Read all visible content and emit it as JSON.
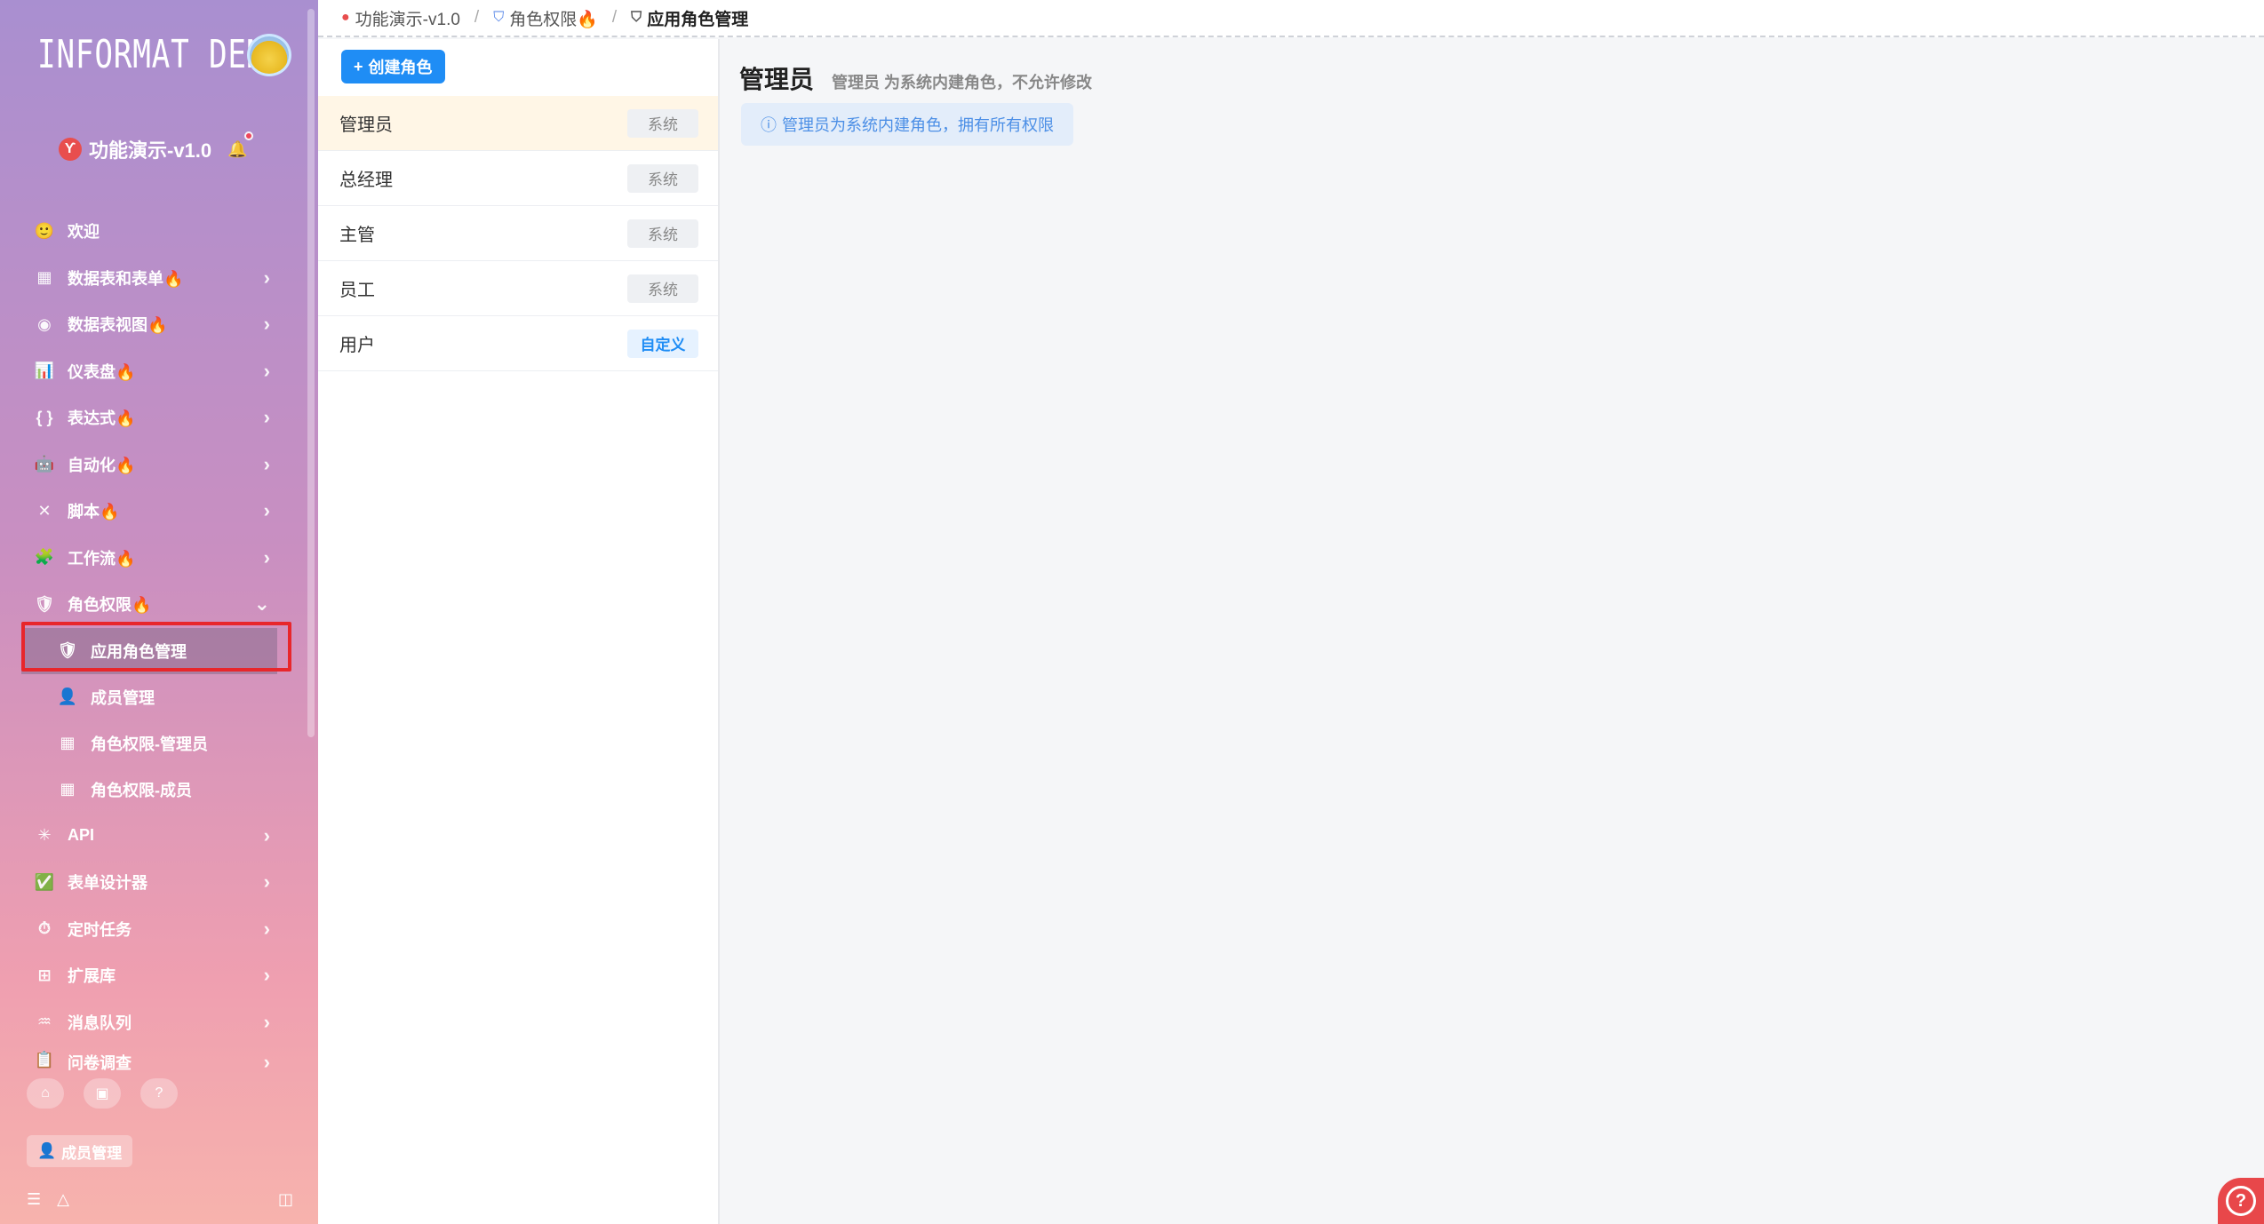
{
  "sidebar": {
    "logo_text": "INFORMAT DEMO",
    "app_name": "功能演示-v1.0",
    "menu": [
      {
        "icon": "🙂",
        "label": "欢迎"
      },
      {
        "icon": "▦",
        "label": "数据表和表单🔥",
        "chevron": "›"
      },
      {
        "icon": "◉",
        "label": "数据表视图🔥",
        "chevron": "›"
      },
      {
        "icon": "📊",
        "label": "仪表盘🔥",
        "chevron": "›"
      },
      {
        "icon": "{ }",
        "label": "表达式🔥",
        "chevron": "›"
      },
      {
        "icon": "🤖",
        "label": "自动化🔥",
        "chevron": "›"
      },
      {
        "icon": "✕",
        "label": "脚本🔥",
        "chevron": "›"
      },
      {
        "icon": "🧩",
        "label": "工作流🔥",
        "chevron": "›"
      },
      {
        "icon": "🛡",
        "label": "角色权限🔥",
        "chevron": "⌄"
      }
    ],
    "submenu": [
      {
        "icon": "🛡",
        "label": "应用角色管理"
      },
      {
        "icon": "👤",
        "label": "成员管理"
      },
      {
        "icon": "▦",
        "label": "角色权限-管理员"
      },
      {
        "icon": "▦",
        "label": "角色权限-成员"
      }
    ],
    "menu2": [
      {
        "icon": "✳",
        "label": "API",
        "chevron": "›"
      },
      {
        "icon": "✅",
        "label": "表单设计器",
        "chevron": "›"
      },
      {
        "icon": "⏱",
        "label": "定时任务",
        "chevron": "›"
      },
      {
        "icon": "⊞",
        "label": "扩展库",
        "chevron": "›"
      },
      {
        "icon": "♒",
        "label": "消息队列",
        "chevron": "›"
      },
      {
        "icon": "📋",
        "label": "问卷调查",
        "chevron": "›"
      }
    ],
    "member_button": "成员管理"
  },
  "breadcrumb": {
    "items": [
      "功能演示-v1.0",
      "角色权限🔥",
      "应用角色管理"
    ]
  },
  "role_panel": {
    "create_button": "创建角色",
    "roles": [
      {
        "name": "管理员",
        "tag": "系统"
      },
      {
        "name": "总经理",
        "tag": "系统"
      },
      {
        "name": "主管",
        "tag": "系统"
      },
      {
        "name": "员工",
        "tag": "系统"
      },
      {
        "name": "用户",
        "tag": "自定义"
      }
    ]
  },
  "detail": {
    "title": "管理员",
    "subtitle": "管理员 为系统内建角色，不允许修改",
    "note": "管理员为系统内建角色，拥有所有权限"
  },
  "colors": {
    "accent": "#1f8df5",
    "selected_row": "#fff6e6",
    "highlight_border": "#e8262b"
  }
}
